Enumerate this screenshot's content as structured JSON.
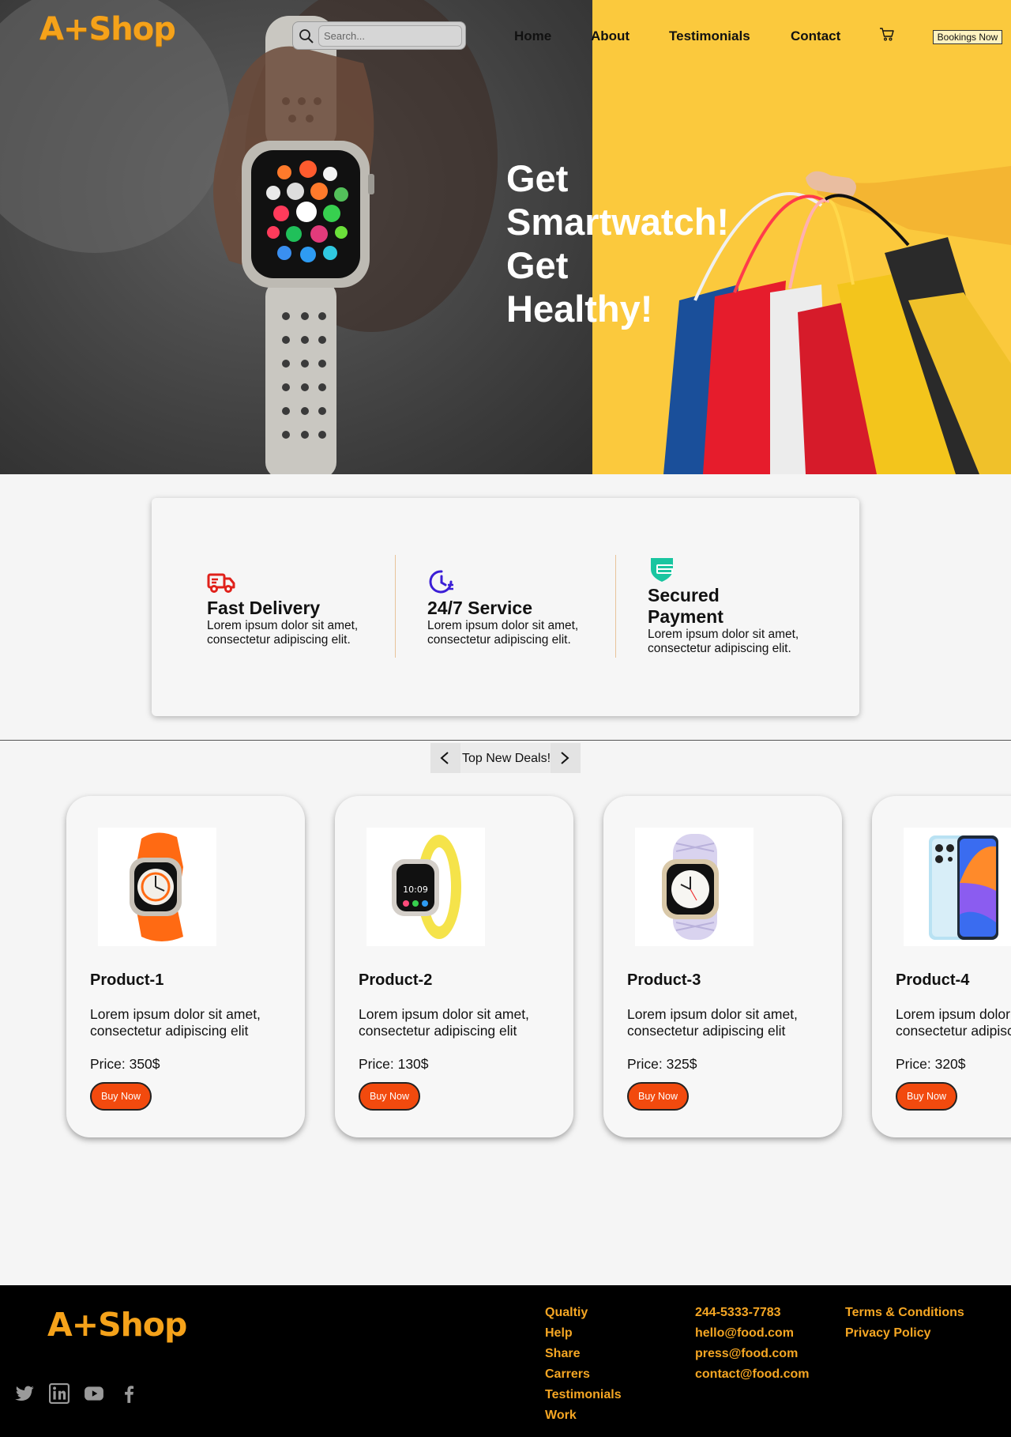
{
  "brand": {
    "logo": "A+Shop"
  },
  "header": {
    "search": {
      "placeholder": "Search...",
      "icon": "search-icon"
    },
    "nav": [
      {
        "label": "Home"
      },
      {
        "label": "About"
      },
      {
        "label": "Testimonials"
      },
      {
        "label": "Contact"
      }
    ],
    "cart_icon": "cart-icon",
    "booking_label": "Bookings Now"
  },
  "hero": {
    "lines": [
      "Get",
      "Smartwatch!",
      "Get",
      "Healthy!"
    ]
  },
  "features": [
    {
      "icon": "truck-icon",
      "title": "Fast Delivery",
      "text": "Lorem ipsum dolor sit amet, consectetur adipiscing elit.",
      "color": "#e0211b"
    },
    {
      "icon": "clock-icon",
      "title": "24/7 Service",
      "text": "Lorem ipsum dolor sit amet, consectetur adipiscing elit.",
      "color": "#3b1ed6"
    },
    {
      "icon": "shield-card-icon",
      "title_line1": "Secured",
      "title_line2": "Payment",
      "text": "Lorem ipsum dolor sit amet, consectetur adipiscing elit.",
      "color": "#19c5a0"
    }
  ],
  "deals": {
    "label": "Top New Deals!"
  },
  "products": [
    {
      "name": "Product-1",
      "desc1": "Lorem ipsum dolor sit amet,",
      "desc2": "consectetur adipiscing elit",
      "price": "Price: 350$",
      "buy": "Buy Now",
      "band_color": "#ff6a13"
    },
    {
      "name": "Product-2",
      "desc1": "Lorem ipsum dolor sit amet,",
      "desc2": "consectetur adipiscing elit",
      "price": "Price: 130$",
      "buy": "Buy Now",
      "band_color": "#f5e34a"
    },
    {
      "name": "Product-3",
      "desc1": "Lorem ipsum dolor sit amet,",
      "desc2": "consectetur adipiscing elit",
      "price": "Price: 325$",
      "buy": "Buy Now",
      "band_color": "#cfc8e8"
    },
    {
      "name": "Product-4",
      "desc1": "Lorem ipsum dolor sit amet,",
      "desc2": "consectetur adipiscing elit",
      "price": "Price: 320$",
      "buy": "Buy Now",
      "band_color": "#9ad6ef"
    }
  ],
  "footer": {
    "col1": [
      "Qualtiy",
      "Help",
      "Share",
      "Carrers",
      "Testimonials",
      "Work"
    ],
    "col2": [
      "244-5333-7783",
      "hello@food.com",
      "press@food.com",
      "contact@food.com"
    ],
    "col3": [
      "Terms & Conditions",
      "Privacy Policy"
    ],
    "social": [
      "twitter-icon",
      "linkedin-icon",
      "youtube-icon",
      "facebook-icon"
    ]
  },
  "colors": {
    "accent": "#f5a623",
    "hero_yellow": "#fbc93d",
    "buy_button": "#f24a0e"
  }
}
